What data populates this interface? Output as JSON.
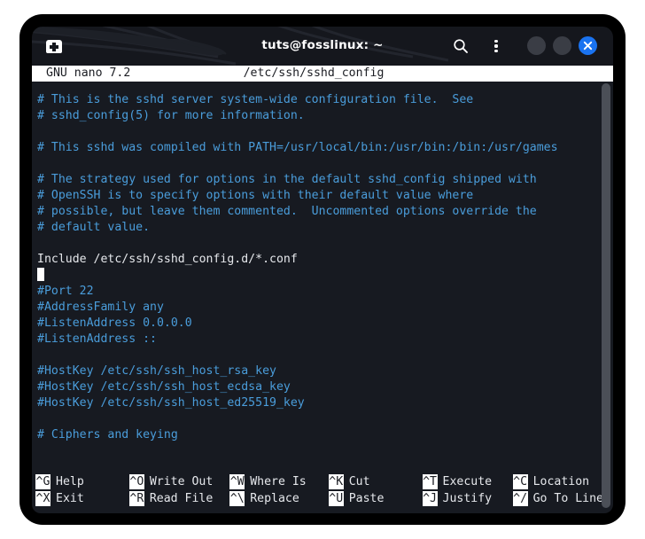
{
  "window": {
    "title": "tuts@fosslinux: ~",
    "new_tab_icon": "new-tab-icon",
    "search_icon": "search-icon",
    "menu_icon": "kebab-menu-icon",
    "minimize_icon": "minimize-icon",
    "maximize_icon": "maximize-icon",
    "close_icon": "close-icon",
    "accent_close_color": "#1a73f0",
    "titlebar_color": "#15171d",
    "terminal_bg_color": "#171a21"
  },
  "nano": {
    "version_label": "GNU nano 7.2",
    "filename": "/etc/ssh/sshd_config",
    "comment_color": "#4a9ddb",
    "text_color": "#e6e8ec",
    "lines": [
      {
        "text": "# This is the sshd server system-wide configuration file.  See",
        "type": "comment"
      },
      {
        "text": "# sshd_config(5) for more information.",
        "type": "comment"
      },
      {
        "text": "",
        "type": "blank"
      },
      {
        "text": "# This sshd was compiled with PATH=/usr/local/bin:/usr/bin:/bin:/usr/games",
        "type": "comment"
      },
      {
        "text": "",
        "type": "blank"
      },
      {
        "text": "# The strategy used for options in the default sshd_config shipped with",
        "type": "comment"
      },
      {
        "text": "# OpenSSH is to specify options with their default value where",
        "type": "comment"
      },
      {
        "text": "# possible, but leave them commented.  Uncommented options override the",
        "type": "comment"
      },
      {
        "text": "# default value.",
        "type": "comment"
      },
      {
        "text": "",
        "type": "blank"
      },
      {
        "text": "Include /etc/ssh/sshd_config.d/*.conf",
        "type": "text"
      },
      {
        "text": "",
        "type": "cursor"
      },
      {
        "text": "#Port 22",
        "type": "comment"
      },
      {
        "text": "#AddressFamily any",
        "type": "comment"
      },
      {
        "text": "#ListenAddress 0.0.0.0",
        "type": "comment"
      },
      {
        "text": "#ListenAddress ::",
        "type": "comment"
      },
      {
        "text": "",
        "type": "blank"
      },
      {
        "text": "#HostKey /etc/ssh/ssh_host_rsa_key",
        "type": "comment"
      },
      {
        "text": "#HostKey /etc/ssh/ssh_host_ecdsa_key",
        "type": "comment"
      },
      {
        "text": "#HostKey /etc/ssh/ssh_host_ed25519_key",
        "type": "comment"
      },
      {
        "text": "",
        "type": "blank"
      },
      {
        "text": "# Ciphers and keying",
        "type": "comment"
      }
    ],
    "shortcuts": [
      {
        "top_key": "^G",
        "top_label": "Help",
        "bottom_key": "^X",
        "bottom_label": "Exit"
      },
      {
        "top_key": "^O",
        "top_label": "Write Out",
        "bottom_key": "^R",
        "bottom_label": "Read File"
      },
      {
        "top_key": "^W",
        "top_label": "Where Is",
        "bottom_key": "^\\",
        "bottom_label": "Replace"
      },
      {
        "top_key": "^K",
        "top_label": "Cut",
        "bottom_key": "^U",
        "bottom_label": "Paste"
      },
      {
        "top_key": "^T",
        "top_label": "Execute",
        "bottom_key": "^J",
        "bottom_label": "Justify"
      },
      {
        "top_key": "^C",
        "top_label": "Location",
        "bottom_key": "^/",
        "bottom_label": "Go To Line"
      }
    ]
  }
}
